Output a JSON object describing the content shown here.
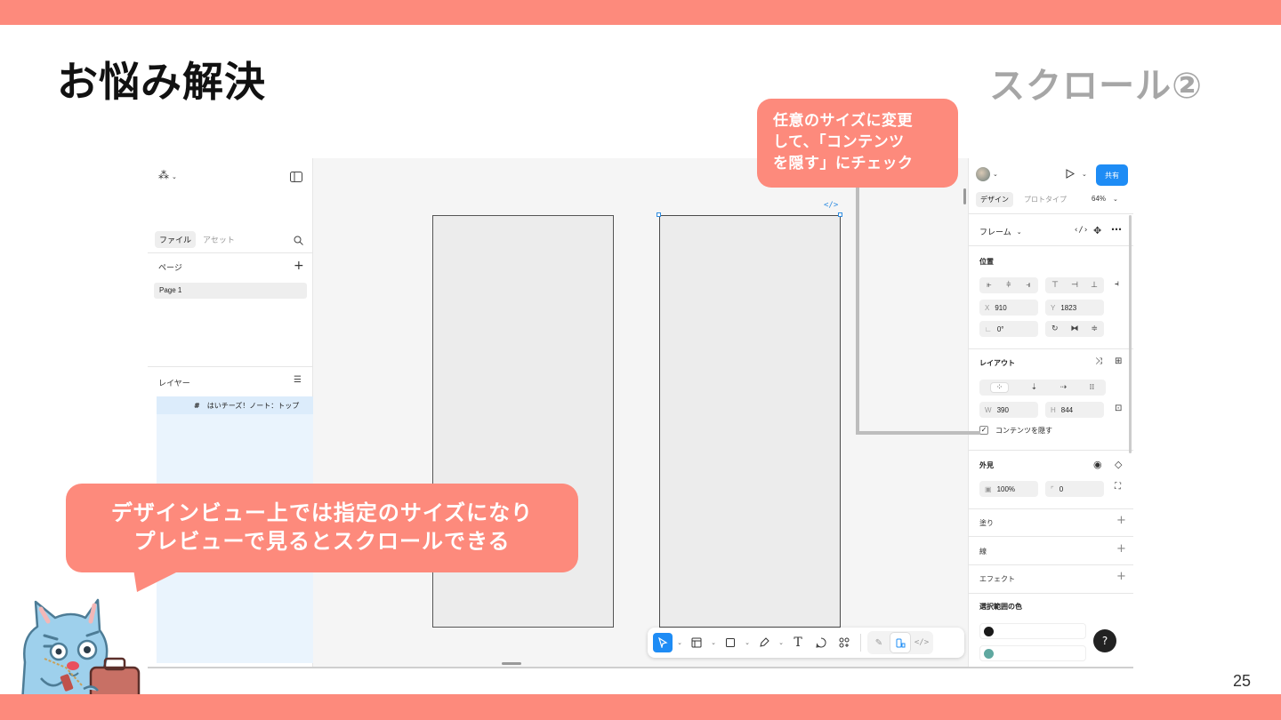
{
  "slide": {
    "title": "お悩み解決",
    "subtitle": "スクロール②",
    "page_number": "25",
    "colors": {
      "accent": "#fd8a7c",
      "subtitle": "#a6a6a6"
    }
  },
  "callouts": {
    "right": {
      "line1": "任意のサイズに変更",
      "line2": "して、「コンテンツ",
      "line3": "を隠す」にチェック"
    },
    "left": {
      "line1": "デザインビュー上では指定のサイズになり",
      "line2": "プレビューで見るとスクロールできる"
    }
  },
  "figma": {
    "left_panel": {
      "menu_icon": "figma-logo-icon",
      "tabs": [
        "ファイル",
        "アセット"
      ],
      "pages_label": "ページ",
      "pages": [
        "Page 1"
      ],
      "layers_label": "レイヤー",
      "layers": [
        {
          "icon": "#",
          "name": "はいチーズ！ノート：トップ"
        }
      ]
    },
    "canvas": {
      "code_badge": "</>"
    },
    "toolbar": {
      "tools": [
        "move-icon",
        "frame-icon",
        "rectangle-icon",
        "pen-icon",
        "text-icon",
        "comment-icon",
        "actions-icon"
      ],
      "text_tool": "T",
      "modes": [
        "draw-icon",
        "design-icon",
        "dev-icon"
      ]
    },
    "right_panel": {
      "share_label": "共有",
      "tabs": [
        "デザイン",
        "プロトタイプ"
      ],
      "zoom": "64%",
      "frame_label": "フレーム",
      "position_label": "位置",
      "x_label": "X",
      "x_value": "910",
      "y_label": "Y",
      "y_value": "1823",
      "rotation_value": "0°",
      "layout_label": "レイアウト",
      "w_label": "W",
      "w_value": "390",
      "h_label": "H",
      "h_value": "844",
      "clip_content_label": "コンテンツを隠す",
      "clip_content_checked": true,
      "appearance_label": "外見",
      "opacity_value": "100%",
      "radius_value": "0",
      "fill_label": "塗り",
      "stroke_label": "線",
      "effect_label": "エフェクト",
      "selection_colors_label": "選択範囲の色",
      "selection_colors": [
        "#1a1a1a",
        "#5fa8a0"
      ],
      "help_label": "?"
    }
  }
}
